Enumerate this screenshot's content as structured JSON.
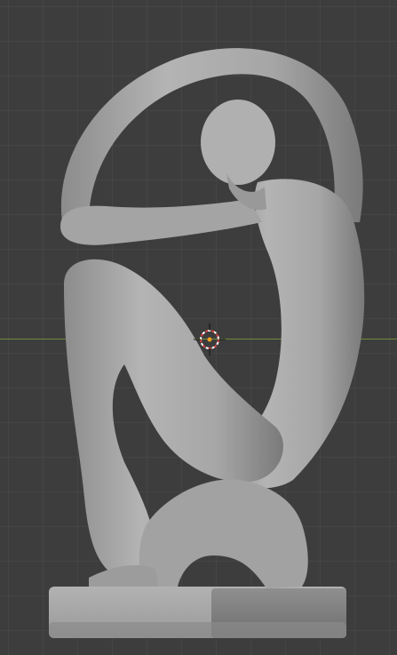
{
  "viewport": {
    "background_color": "#3d3d3d",
    "grid_color": "#464646",
    "x_axis_color": "#6f8a3a",
    "object_color": "#a9a9a9",
    "cursor_ring_colors": [
      "#d64040",
      "#ffffff"
    ],
    "origin_dot_color": "#f0a020"
  },
  "object": {
    "icon": "sculpture-seated-figure"
  },
  "cursor": {
    "icon": "3d-cursor-icon"
  }
}
